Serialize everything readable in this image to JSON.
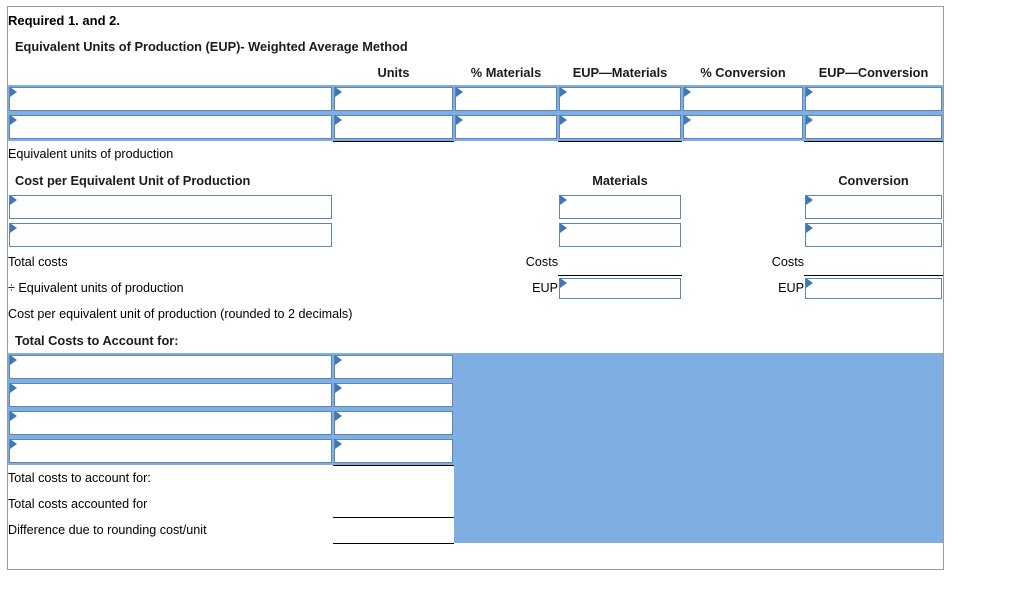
{
  "worksheet": {
    "title": "Required 1. and 2.",
    "sections": {
      "eup_header": "Equivalent Units of Production (EUP)- Weighted Average Method",
      "cost_per_eup_header": "Cost per Equivalent Unit of Production",
      "total_costs_header": "Total Costs to Account for:"
    },
    "columns": {
      "label": "",
      "units": "Units",
      "pct_materials": "% Materials",
      "eup_materials": "EUP—Materials",
      "pct_conversion": "% Conversion",
      "eup_conversion": "EUP—Conversion"
    },
    "subheaders": {
      "materials": "Materials",
      "conversion": "Conversion"
    },
    "rows": {
      "equivalent_units_of_production": "Equivalent units of production",
      "total_costs": "Total costs",
      "divide_equivalent_units": "÷ Equivalent units of production",
      "cost_per_eup_rounded": "Cost per equivalent unit of production (rounded to 2 decimals)",
      "total_costs_to_account_for": "Total costs to account for:",
      "total_costs_accounted_for": "Total costs accounted for",
      "difference_due_to_rounding": "Difference due to rounding cost/unit"
    },
    "inline_labels": {
      "costs": "Costs",
      "eup": "EUP"
    },
    "input_cells": {
      "value": "",
      "placeholder": ""
    },
    "colors": {
      "band_blue": "#7fafe2",
      "input_border_blue": "#5d86b3",
      "answer_yellow": "#ffffaa",
      "grid_gray": "#8a8a8a",
      "rule_black": "#000000"
    },
    "icons": {
      "dropdown_marker": "dropdown-marker-icon"
    }
  }
}
